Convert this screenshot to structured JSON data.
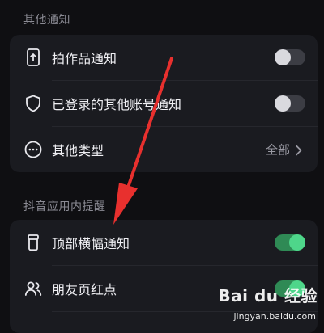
{
  "sections": {
    "other_notifications": {
      "title": "其他通知",
      "rows": {
        "shoot_works": {
          "label": "拍作品通知",
          "icon": "phone-upload-icon",
          "toggle": "off"
        },
        "other_accounts": {
          "label": "已登录的其他账号通知",
          "icon": "shield-icon",
          "toggle": "off"
        },
        "other_types": {
          "label": "其他类型",
          "icon": "more-circle-icon",
          "value": "全部"
        }
      }
    },
    "in_app_reminders": {
      "title": "抖音应用内提醒",
      "rows": {
        "top_banner": {
          "label": "顶部横幅通知",
          "icon": "banner-icon",
          "toggle": "on"
        },
        "friends_dot": {
          "label": "朋友页红点",
          "icon": "friends-icon",
          "toggle": "on"
        }
      }
    }
  },
  "annotation": {
    "color": "#e8302e",
    "shape": "red-arrow"
  },
  "watermark": {
    "logo": "Bai du 经验",
    "url": "jingyan.baidu.com"
  },
  "colors": {
    "background": "#0f0f12",
    "card": "#1a1b20",
    "toggle_on": "#4ed68a",
    "toggle_off_track": "#3c3d44"
  }
}
